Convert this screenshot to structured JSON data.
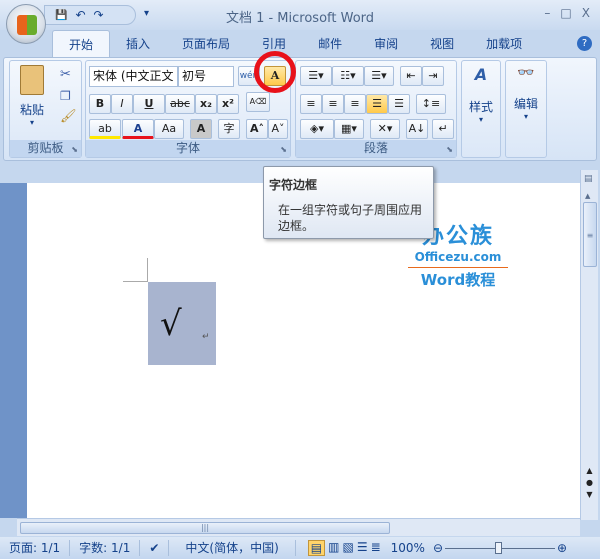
{
  "window": {
    "title": "文档 1 - Microsoft Word",
    "minimize": "–",
    "maximize": "□",
    "close": "X"
  },
  "qat": {
    "save": "💾",
    "undo": "↶",
    "redo": "↷",
    "customize": "▾"
  },
  "tabs": [
    "开始",
    "插入",
    "页面布局",
    "引用",
    "邮件",
    "审阅",
    "视图",
    "加载项"
  ],
  "help": "?",
  "ribbon": {
    "clipboard": {
      "label": "剪贴板",
      "paste": "粘贴"
    },
    "font": {
      "label": "字体",
      "font_name": "宋体 (中文正文",
      "font_size": "初号",
      "bold": "B",
      "italic": "I",
      "underline": "U",
      "strike": "abc",
      "subscript": "x₂",
      "superscript": "x²",
      "highlight": "ab",
      "font_color": "A",
      "change_case": "Aa",
      "char_shading": "A",
      "enclose": "字",
      "grow": "A˄",
      "shrink": "A˅",
      "phonetic": "wén",
      "border": "A"
    },
    "paragraph": {
      "label": "段落"
    },
    "styles": {
      "label": "样式"
    },
    "editing": {
      "label": "编辑"
    }
  },
  "tooltip": {
    "title": "字符边框",
    "body": "在一组字符或句子周围应用边框。"
  },
  "watermark": {
    "brand": "办公族",
    "site": "Officezu.com",
    "subtitle": "Word教程"
  },
  "document": {
    "char": "√",
    "para_mark": "↵"
  },
  "status": {
    "page": "页面: 1/1",
    "words": "字数: 1/1",
    "language": "中文(简体，中国)",
    "zoom": "100%"
  }
}
